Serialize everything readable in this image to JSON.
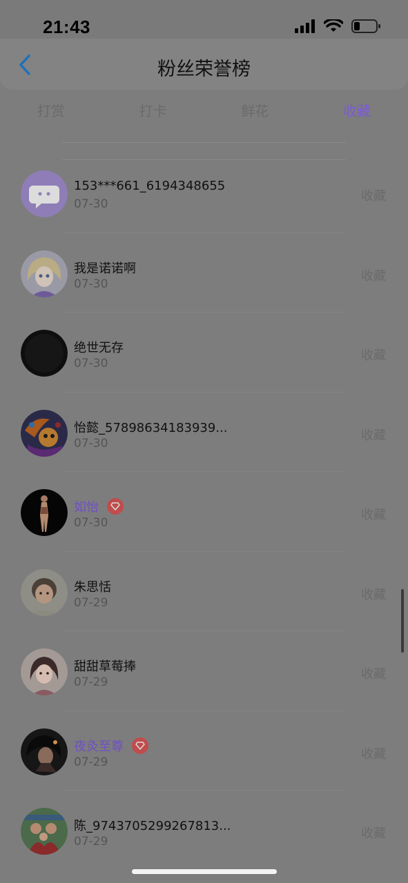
{
  "status_bar": {
    "time": "21:43"
  },
  "header": {
    "title": "粉丝荣誉榜",
    "back_icon": "chevron-left-icon"
  },
  "tabs": [
    {
      "label": "打赏",
      "active": false
    },
    {
      "label": "打卡",
      "active": false
    },
    {
      "label": "鲜花",
      "active": false
    },
    {
      "label": "收藏",
      "active": true
    }
  ],
  "list": [
    {
      "name": "153***661_6194348655",
      "date": "07-30",
      "action": "收藏",
      "vip": false,
      "avatar": "chat-bubble-avatar"
    },
    {
      "name": "我是诺诺啊",
      "date": "07-30",
      "action": "收藏",
      "vip": false,
      "avatar": "anime-girl-avatar"
    },
    {
      "name": "绝世无存",
      "date": "07-30",
      "action": "收藏",
      "vip": false,
      "avatar": "black-avatar"
    },
    {
      "name": "怡懿_57898634183939...",
      "date": "07-30",
      "action": "收藏",
      "vip": false,
      "avatar": "colorful-avatar"
    },
    {
      "name": "如怡",
      "date": "07-30",
      "action": "收藏",
      "vip": true,
      "avatar": "figure-avatar"
    },
    {
      "name": "朱思恬",
      "date": "07-29",
      "action": "收藏",
      "vip": false,
      "avatar": "child-photo-avatar"
    },
    {
      "name": "甜甜草莓捧",
      "date": "07-29",
      "action": "收藏",
      "vip": false,
      "avatar": "illustrated-girl-avatar"
    },
    {
      "name": "夜灸至尊",
      "date": "07-29",
      "action": "收藏",
      "vip": true,
      "avatar": "dark-anime-avatar"
    },
    {
      "name": "陈_9743705299267813...",
      "date": "07-29",
      "action": "收藏",
      "vip": false,
      "avatar": "family-photo-avatar"
    }
  ],
  "colors": {
    "accent": "#7b5bd1",
    "vip_badge": "#c04c4c",
    "overlay_background": "#7d7d7d"
  }
}
